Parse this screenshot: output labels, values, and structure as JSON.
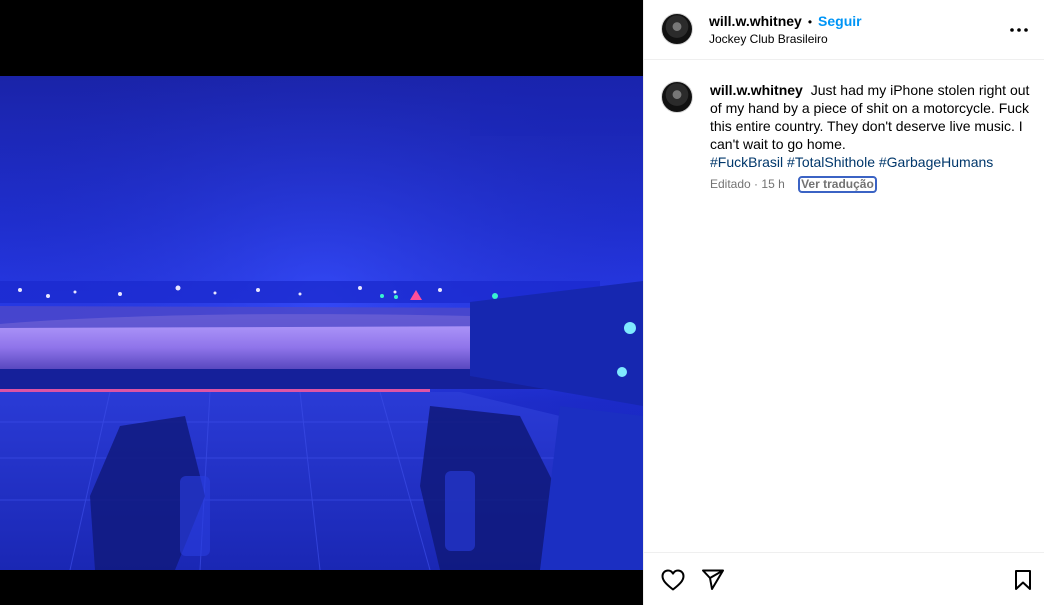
{
  "post": {
    "username": "will.w.whitney",
    "separator": "•",
    "follow_label": "Seguir",
    "location": "Jockey Club Brasileiro",
    "media_alt": "Concert crowd viewed from stage under blue lights"
  },
  "caption": {
    "username": "will.w.whitney",
    "text": "Just had my iPhone stolen right out of my hand by a piece of shit on a motorcycle. Fuck this entire country. They don't deserve live music. I can't wait to go home.",
    "hashtags": [
      "#FuckBrasil",
      "#TotalShithole",
      "#GarbageHumans"
    ],
    "edited_label": "Editado",
    "time_sep": "·",
    "time": "15 h",
    "translate_label": "Ver tradução"
  },
  "icons": {
    "more": "more-options-icon",
    "like": "heart-icon",
    "share": "paper-plane-icon",
    "save": "bookmark-icon"
  },
  "colors": {
    "follow": "#0095f6",
    "hashtag": "#00376b",
    "meta": "#737373",
    "stage_blue": "#1f2fd0"
  }
}
